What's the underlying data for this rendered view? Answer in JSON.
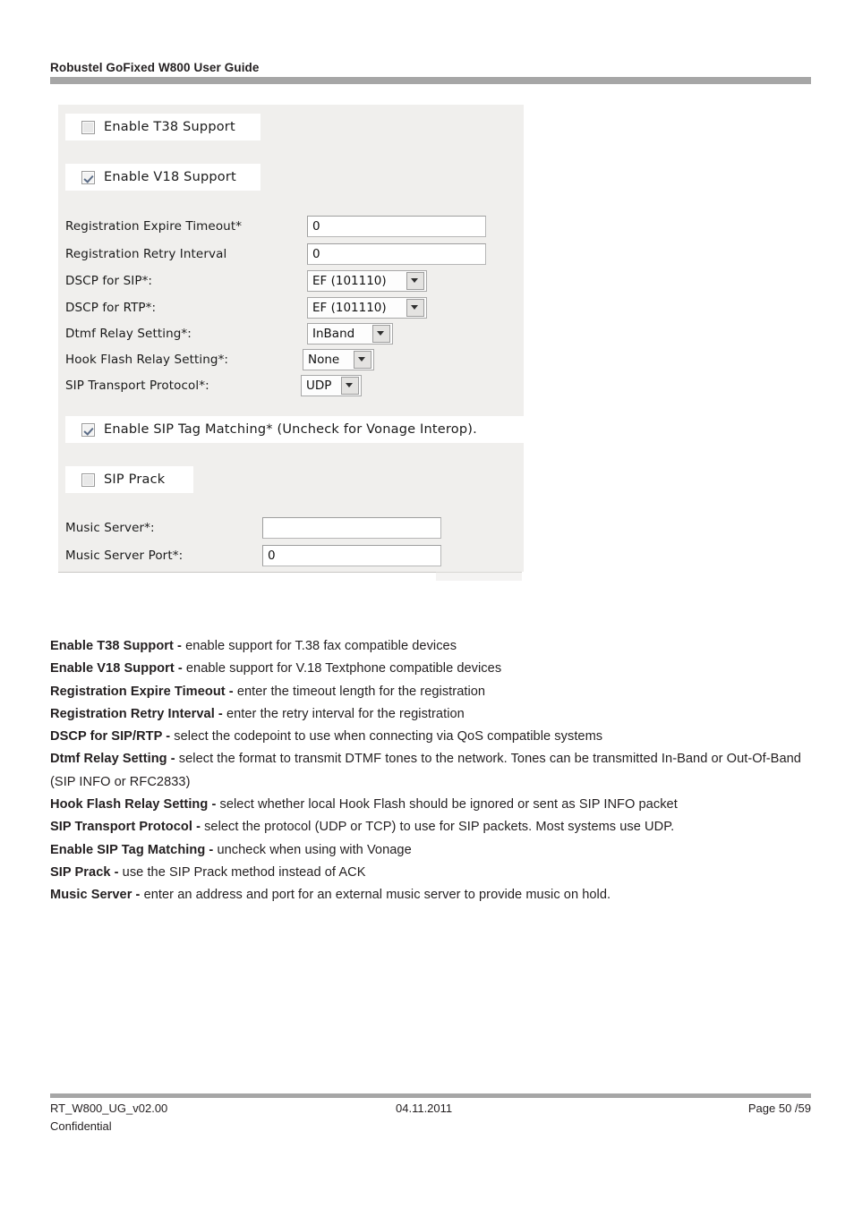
{
  "header": {
    "title": "Robustel GoFixed W800 User Guide"
  },
  "screenshot": {
    "checkbox_t38": {
      "label": "Enable T38 Support",
      "checked": false
    },
    "checkbox_v18": {
      "label": "Enable V18 Support",
      "checked": true
    },
    "fields": [
      {
        "label": "Registration Expire Timeout*",
        "type": "text",
        "value": "0"
      },
      {
        "label": "Registration Retry Interval",
        "type": "text",
        "value": "0"
      },
      {
        "label": "DSCP for SIP*:",
        "type": "select",
        "value": "EF (101110)"
      },
      {
        "label": "DSCP for RTP*:",
        "type": "select",
        "value": "EF (101110)"
      },
      {
        "label": "Dtmf Relay Setting*:",
        "type": "select",
        "value": "InBand"
      },
      {
        "label": "Hook Flash Relay Setting*:",
        "type": "select",
        "value": "None"
      },
      {
        "label": "SIP Transport Protocol*:",
        "type": "select",
        "value": "UDP"
      }
    ],
    "checkbox_sip_tag": {
      "label": "Enable SIP Tag Matching* (Uncheck for Vonage Interop).",
      "checked": true
    },
    "checkbox_sip_prack": {
      "label": "SIP Prack",
      "checked": false
    },
    "music_fields": [
      {
        "label": "Music Server*:",
        "type": "text",
        "value": ""
      },
      {
        "label": "Music Server Port*:",
        "type": "text",
        "value": "0"
      }
    ]
  },
  "descriptions": [
    {
      "term": "Enable T38 Support - ",
      "text": "enable support for T.38 fax compatible devices"
    },
    {
      "term": "Enable V18 Support - ",
      "text": "enable support for V.18 Textphone compatible devices"
    },
    {
      "term": "Registration Expire Timeout - ",
      "text": "enter the timeout length for the registration"
    },
    {
      "term": "Registration Retry Interval - ",
      "text": "enter the retry interval for the registration"
    },
    {
      "term": "DSCP for SIP/RTP - ",
      "text": "select the codepoint to use when connecting via QoS compatible systems"
    },
    {
      "term": "Dtmf Relay Setting - ",
      "text": "select the format to transmit DTMF tones to the network. Tones can be transmitted In-Band or Out-Of-Band (SIP INFO or RFC2833)"
    },
    {
      "term": "Hook Flash Relay Setting - ",
      "text": "select whether local Hook Flash should be ignored or sent as SIP INFO packet"
    },
    {
      "term": "SIP Transport Protocol - ",
      "text": "select the protocol (UDP or TCP) to use for SIP packets. Most systems use UDP."
    },
    {
      "term": "Enable SIP Tag Matching - ",
      "text": "uncheck when using with Vonage"
    },
    {
      "term": "SIP Prack - ",
      "text": "use the SIP Prack method instead of ACK"
    },
    {
      "term": "Music Server - ",
      "text": "enter an address and port for an external music server to provide music on hold."
    }
  ],
  "footer": {
    "document_id": "RT_W800_UG_v02.00",
    "date": "04.11.2011",
    "page": "Page 50 /59",
    "confidential": "Confidential"
  }
}
